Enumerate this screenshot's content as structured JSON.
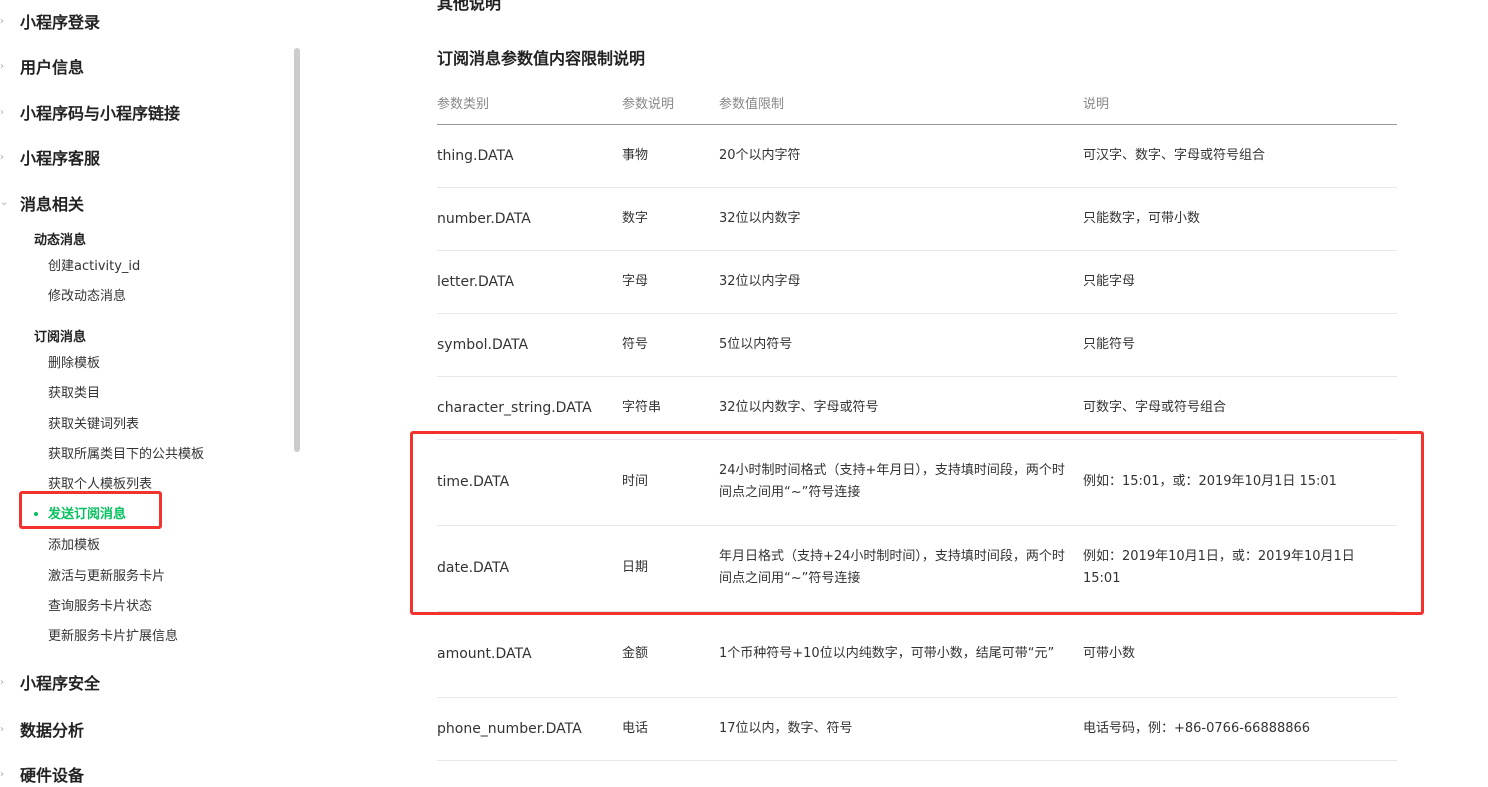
{
  "sidebar": {
    "sections": [
      {
        "label": "小程序登录"
      },
      {
        "label": "用户信息"
      },
      {
        "label": "小程序码与小程序链接"
      },
      {
        "label": "小程序客服"
      },
      {
        "label": "消息相关"
      }
    ],
    "groups": {
      "dynamic": {
        "title": "动态消息",
        "items": [
          "创建activity_id",
          "修改动态消息"
        ]
      },
      "subscribe": {
        "title": "订阅消息",
        "items": [
          "删除模板",
          "获取类目",
          "获取关键词列表",
          "获取所属类目下的公共模板",
          "获取个人模板列表"
        ],
        "active": "发送订阅消息",
        "items_after": [
          "添加模板",
          "激活与更新服务卡片",
          "查询服务卡片状态",
          "更新服务卡片扩展信息"
        ]
      }
    },
    "sections_after": [
      {
        "label": "小程序安全"
      },
      {
        "label": "数据分析"
      },
      {
        "label": "硬件设备"
      }
    ]
  },
  "main": {
    "cut_heading": "其他说明",
    "section_title": "订阅消息参数值内容限制说明",
    "table": {
      "headers": [
        "参数类别",
        "参数说明",
        "参数值限制",
        "说明"
      ],
      "rows": [
        {
          "type": "thing.DATA",
          "desc": "事物",
          "limit": "20个以内字符",
          "note": "可汉字、数字、字母或符号组合"
        },
        {
          "type": "number.DATA",
          "desc": "数字",
          "limit": "32位以内数字",
          "note": "只能数字，可带小数"
        },
        {
          "type": "letter.DATA",
          "desc": "字母",
          "limit": "32位以内字母",
          "note": "只能字母"
        },
        {
          "type": "symbol.DATA",
          "desc": "符号",
          "limit": "5位以内符号",
          "note": "只能符号"
        },
        {
          "type": "character_string.DATA",
          "desc": "字符串",
          "limit": "32位以内数字、字母或符号",
          "note": "可数字、字母或符号组合"
        },
        {
          "type": "time.DATA",
          "desc": "时间",
          "limit": "24小时制时间格式（支持+年月日），支持填时间段，两个时间点之间用“~”符号连接",
          "note": "例如：15:01，或：2019年10月1日 15:01"
        },
        {
          "type": "date.DATA",
          "desc": "日期",
          "limit": "年月日格式（支持+24小时制时间），支持填时间段，两个时间点之间用“~”符号连接",
          "note": "例如：2019年10月1日，或：2019年10月1日 15:01"
        },
        {
          "type": "amount.DATA",
          "desc": "金额",
          "limit": "1个币种符号+10位以内纯数字，可带小数，结尾可带“元”",
          "note": "可带小数"
        },
        {
          "type": "phone_number.DATA",
          "desc": "电话",
          "limit": "17位以内，数字、符号",
          "note": "电话号码，例：+86-0766-66888866"
        }
      ]
    }
  },
  "colors": {
    "accent": "#07c160",
    "highlight": "#f2322d"
  }
}
